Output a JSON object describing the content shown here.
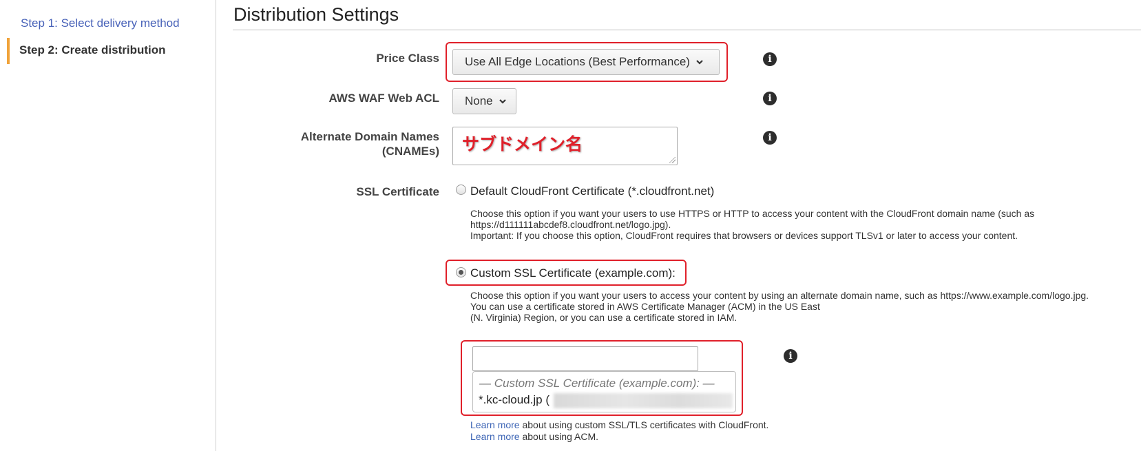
{
  "sidebar": {
    "step1": "Step 1: Select delivery method",
    "step2": "Step 2: Create distribution"
  },
  "page": {
    "title": "Distribution Settings"
  },
  "fields": {
    "price_class": {
      "label": "Price Class",
      "value": "Use All Edge Locations (Best Performance)"
    },
    "waf": {
      "label": "AWS WAF Web ACL",
      "value": "None"
    },
    "cnames": {
      "label_line1": "Alternate Domain Names",
      "label_line2": "(CNAMEs)",
      "annotation": "サブドメイン名"
    },
    "ssl": {
      "label": "SSL Certificate",
      "default_option": "Default CloudFront Certificate (*.cloudfront.net)",
      "default_desc_1": "Choose this option if you want your users to use HTTPS or HTTP to access your content with the CloudFront domain name (such as",
      "default_desc_2": "https://d111111abcdef8.cloudfront.net/logo.jpg).",
      "default_desc_3": "Important: If you choose this option, CloudFront requires that browsers or devices support TLSv1 or later to access your content.",
      "custom_option": "Custom SSL Certificate (example.com):",
      "custom_desc_1": "Choose this option if you want your users to access your content by using an alternate domain name, such as https://www.example.com/logo.jpg.",
      "custom_desc_2": "You can use a certificate stored in AWS Certificate Manager (ACM) in the US East",
      "custom_desc_3": "(N. Virginia) Region, or you can use a certificate stored in IAM.",
      "dropdown_heading": "— Custom SSL Certificate (example.com): —",
      "dropdown_option": "*.kc-cloud.jp (",
      "selected": "custom"
    }
  },
  "learn_more": {
    "link_text": "Learn more",
    "line1_rest": " about using custom SSL/TLS certificates with CloudFront.",
    "line2_rest": " about using ACM."
  },
  "colors": {
    "highlight": "#e0202a",
    "link": "#3c64b5",
    "active_step": "#f0a33a"
  },
  "icons": {
    "info": "info-icon",
    "chevron": "chevron-down-icon"
  }
}
